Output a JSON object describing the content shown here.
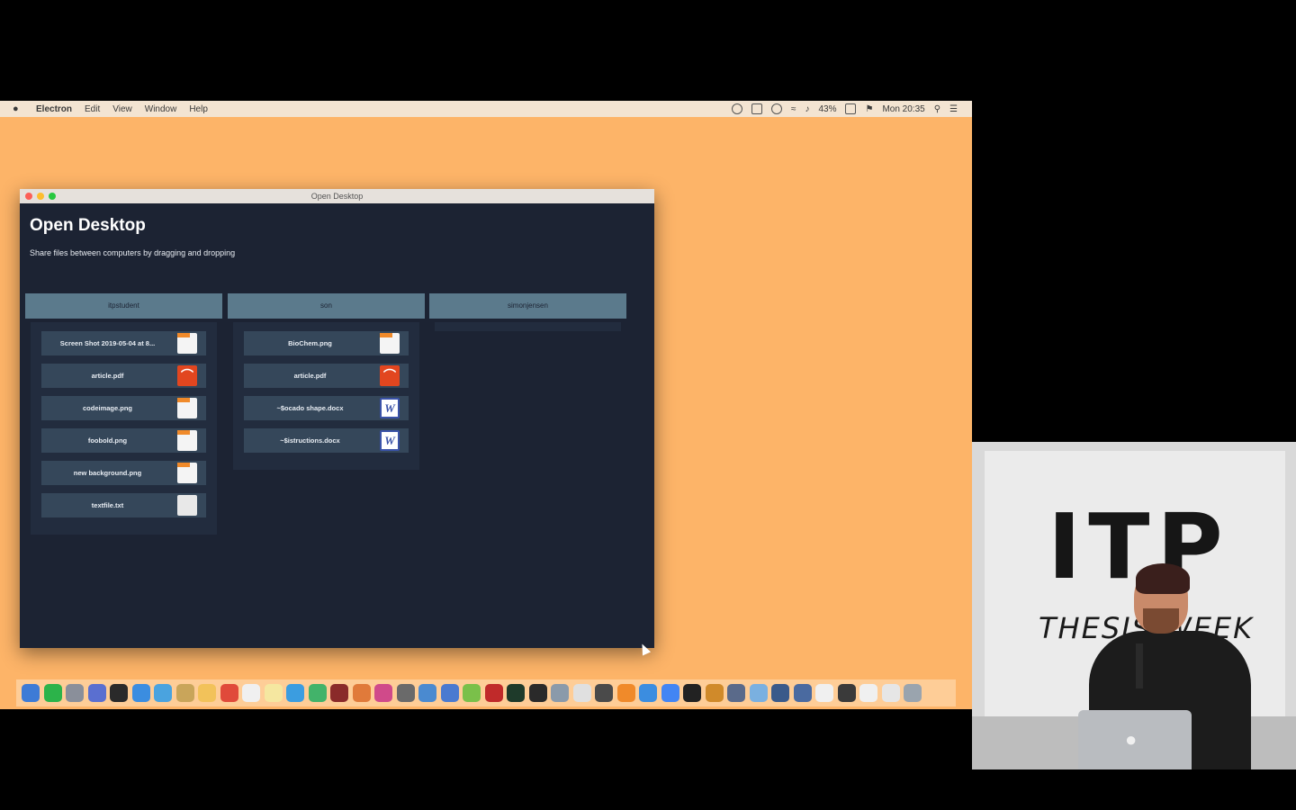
{
  "menubar": {
    "app": "Electron",
    "items": [
      "Edit",
      "View",
      "Window",
      "Help"
    ],
    "battery": "43%",
    "clock": "Mon 20:35"
  },
  "window": {
    "title": "Open Desktop",
    "heading": "Open Desktop",
    "subtitle": "Share files between computers by dragging and dropping"
  },
  "columns": [
    {
      "name": "itpstudent",
      "files": [
        {
          "name": "Screen Shot 2019-05-04 at 8...",
          "type": "image"
        },
        {
          "name": "article.pdf",
          "type": "pdf"
        },
        {
          "name": "codeimage.png",
          "type": "image"
        },
        {
          "name": "foobold.png",
          "type": "image"
        },
        {
          "name": "new background.png",
          "type": "image"
        },
        {
          "name": "textfile.txt",
          "type": "text"
        }
      ]
    },
    {
      "name": "son",
      "files": [
        {
          "name": "BioChem.png",
          "type": "image"
        },
        {
          "name": "article.pdf",
          "type": "pdf"
        },
        {
          "name": "~$ocado shape.docx",
          "type": "word"
        },
        {
          "name": "~$istructions.docx",
          "type": "word"
        }
      ]
    },
    {
      "name": "simonjensen",
      "files": []
    }
  ],
  "video": {
    "sign_big": "ITP",
    "sign_sub": "THESIS WEEK"
  },
  "colors": {
    "desktop": "#fdb468",
    "app_bg": "#1c2333",
    "column_header": "#5b7a8c",
    "file_row": "#35475a"
  },
  "dock_colors": [
    "#3d7bd6",
    "#2cb34a",
    "#8a8f9a",
    "#5a6fd0",
    "#2a2a2a",
    "#3b8de0",
    "#4aa3df",
    "#c9a55a",
    "#f2c25a",
    "#e04a3a",
    "#f0f0f0",
    "#f5e7a0",
    "#3b9de0",
    "#42b36a",
    "#8a2a2a",
    "#e07a3a",
    "#d04a8a",
    "#6a6a6a",
    "#4a8ad0",
    "#4a7ad0",
    "#7ac04a",
    "#c02a2a",
    "#1e3a2a",
    "#2a2a2a",
    "#8a9aaa",
    "#e0e0e0",
    "#4a4a4a",
    "#f08a2a",
    "#3b8de0",
    "#4285f4",
    "#222222",
    "#d08a2a",
    "#5a6a8a",
    "#7ab0e0",
    "#3a5a8a",
    "#4a6aa0",
    "#f0f0f0",
    "#3a3a3a",
    "#f0f0f0",
    "#e6e6e6",
    "#9aa4ae"
  ]
}
